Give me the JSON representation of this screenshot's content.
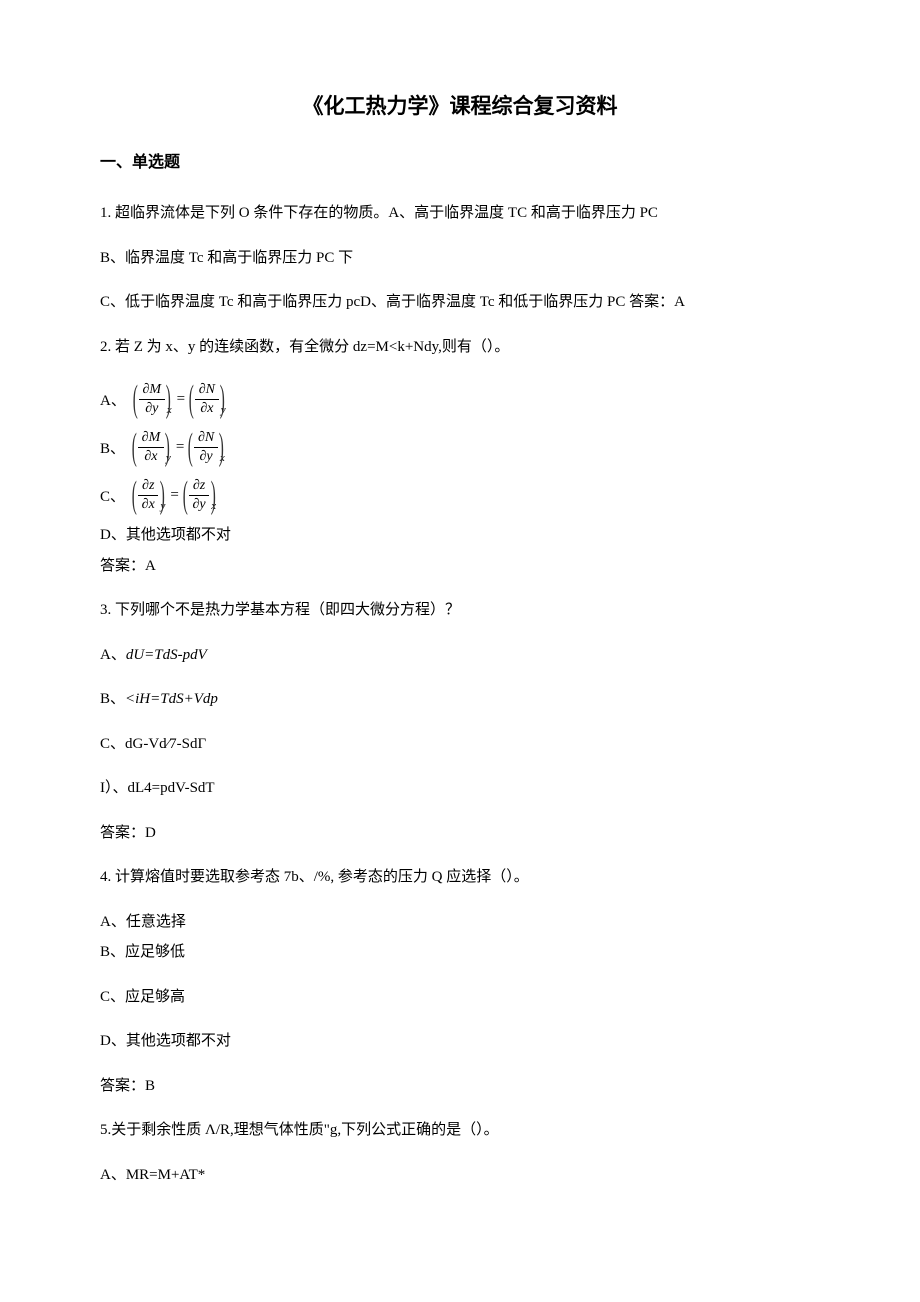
{
  "title": "《化工热力学》课程综合复习资料",
  "section": "一、单选题",
  "q1": {
    "stem": "1. 超临界流体是下列 O 条件下存在的物质。A、高于临界温度 TC 和高于临界压力 PC",
    "optB": "B、临界温度 Tc 和高于临界压力 PC 下",
    "optCD": "C、低于临界温度 Tc 和高于临界压力 pcD、高于临界温度 Tc 和低于临界压力 PC 答案：A"
  },
  "q2": {
    "stem": "2. 若 Z 为 x、y 的连续函数，有全微分 dz=M<k+Ndy,则有（）。",
    "labelA": "A、",
    "labelB": "B、",
    "labelC": "C、",
    "A_num1": "∂M",
    "A_den1": "∂y",
    "A_sub1": "x",
    "A_num2": "∂N",
    "A_den2": "∂x",
    "A_sub2": "y",
    "B_num1": "∂M",
    "B_den1": "∂x",
    "B_sub1": "y",
    "B_num2": "∂N",
    "B_den2": "∂y",
    "B_sub2": "x",
    "C_num1": "∂z",
    "C_den1": "∂x",
    "C_sub1": "y",
    "C_num2": "∂z",
    "C_den2": "∂y",
    "C_sub2": "x",
    "optD": "D、其他选项都不对",
    "ans": "答案：A"
  },
  "q3": {
    "stem": "3. 下列哪个不是热力学基本方程（即四大微分方程）？",
    "optA_prefix": "A、",
    "optA_formula": "dU=TdS-pdV",
    "optB_prefix": "B、",
    "optB_formula": "<iH=TdS+Vdp",
    "optC": "C、dG-Vd⁄7-SdΓ",
    "optD": "I）、dL4=pdV-SdT",
    "ans": "答案：D"
  },
  "q4": {
    "stem": "4. 计算熔值时要选取参考态 7b、/%, 参考态的压力 Q 应选择（）。",
    "optA": "A、任意选择",
    "optB": "B、应足够低",
    "optC": "C、应足够高",
    "optD": "D、其他选项都不对",
    "ans": "答案：B"
  },
  "q5": {
    "stem": "5.关于剩余性质 Λ/R,理想气体性质\"g,下列公式正确的是（）。",
    "optA": "A、MR=M+AT*"
  }
}
